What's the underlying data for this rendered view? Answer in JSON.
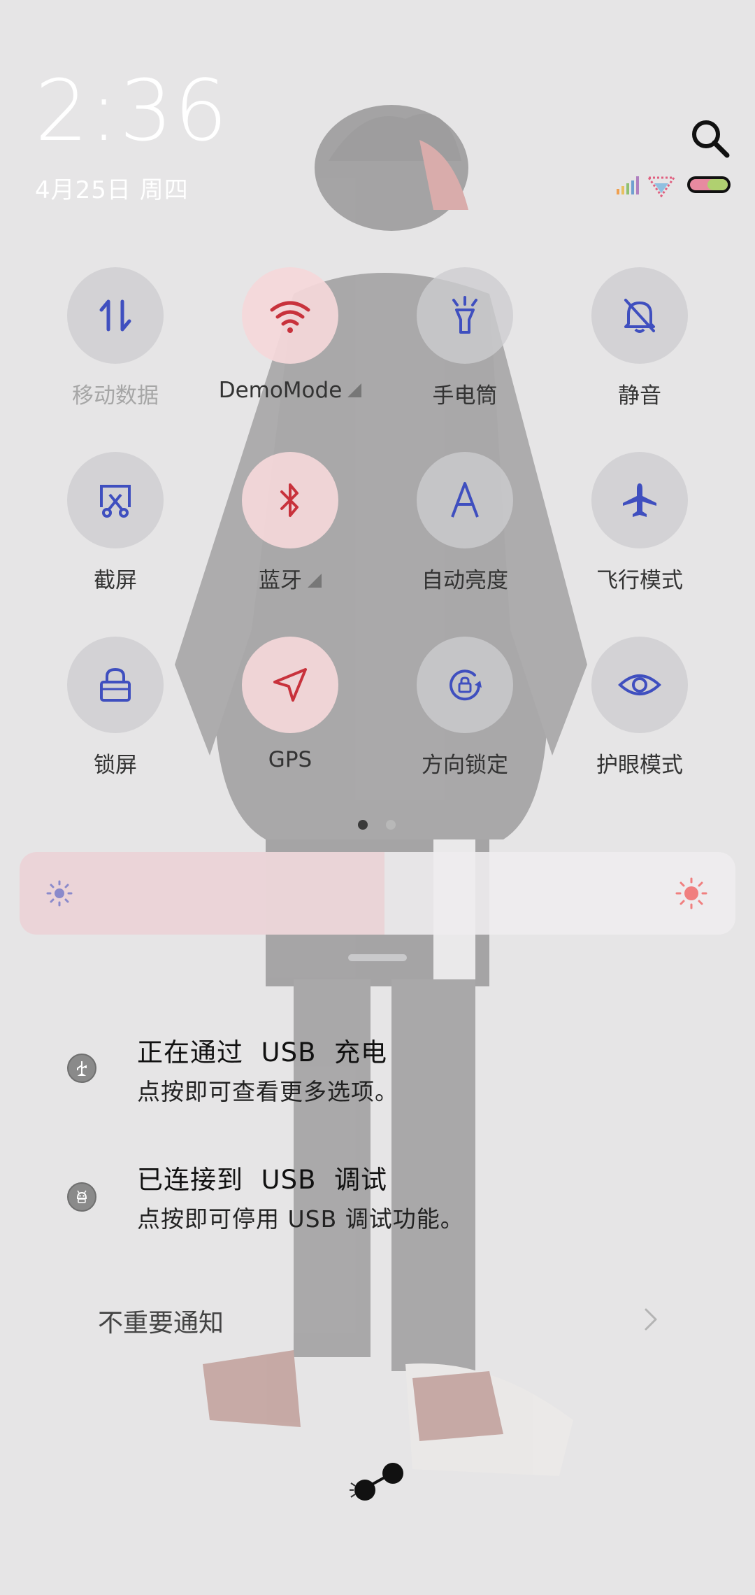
{
  "header": {
    "time": "2:36",
    "date": "4月25日 周四"
  },
  "icons": {
    "search": "search-icon",
    "signal": "signal-icon",
    "wifi": "wifi-icon",
    "battery": "battery-icon"
  },
  "tiles": [
    {
      "label": "移动数据",
      "icon": "mobile-data-icon",
      "active": false
    },
    {
      "label": "DemoMode",
      "icon": "wifi-icon",
      "active": true
    },
    {
      "label": "手电筒",
      "icon": "flashlight-icon",
      "active": false
    },
    {
      "label": "静音",
      "icon": "mute-icon",
      "active": false
    },
    {
      "label": "截屏",
      "icon": "screenshot-icon",
      "active": false
    },
    {
      "label": "蓝牙",
      "icon": "bluetooth-icon",
      "active": true
    },
    {
      "label": "自动亮度",
      "icon": "auto-brightness-icon",
      "active": false
    },
    {
      "label": "飞行模式",
      "icon": "airplane-icon",
      "active": false
    },
    {
      "label": "锁屏",
      "icon": "lock-icon",
      "active": false
    },
    {
      "label": "GPS",
      "icon": "location-icon",
      "active": true
    },
    {
      "label": "方向锁定",
      "icon": "rotation-lock-icon",
      "active": false
    },
    {
      "label": "护眼模式",
      "icon": "eye-icon",
      "active": false
    }
  ],
  "pager": {
    "pages": 2,
    "current": 1
  },
  "brightness": {
    "level": 0.51
  },
  "notifications": [
    {
      "title": "正在通过  USB  充电",
      "text": "点按即可查看更多选项。",
      "icon": "usb-icon"
    },
    {
      "title": "已连接到  USB  调试",
      "text": "点按即可停用 USB 调试功能。",
      "icon": "android-debug-icon"
    }
  ],
  "unimportant_notifications": "不重要通知",
  "colors": {
    "accent_blue": "#3f4fbf",
    "accent_red": "#c8323c",
    "active_tile_bg": "#f5d8da"
  }
}
